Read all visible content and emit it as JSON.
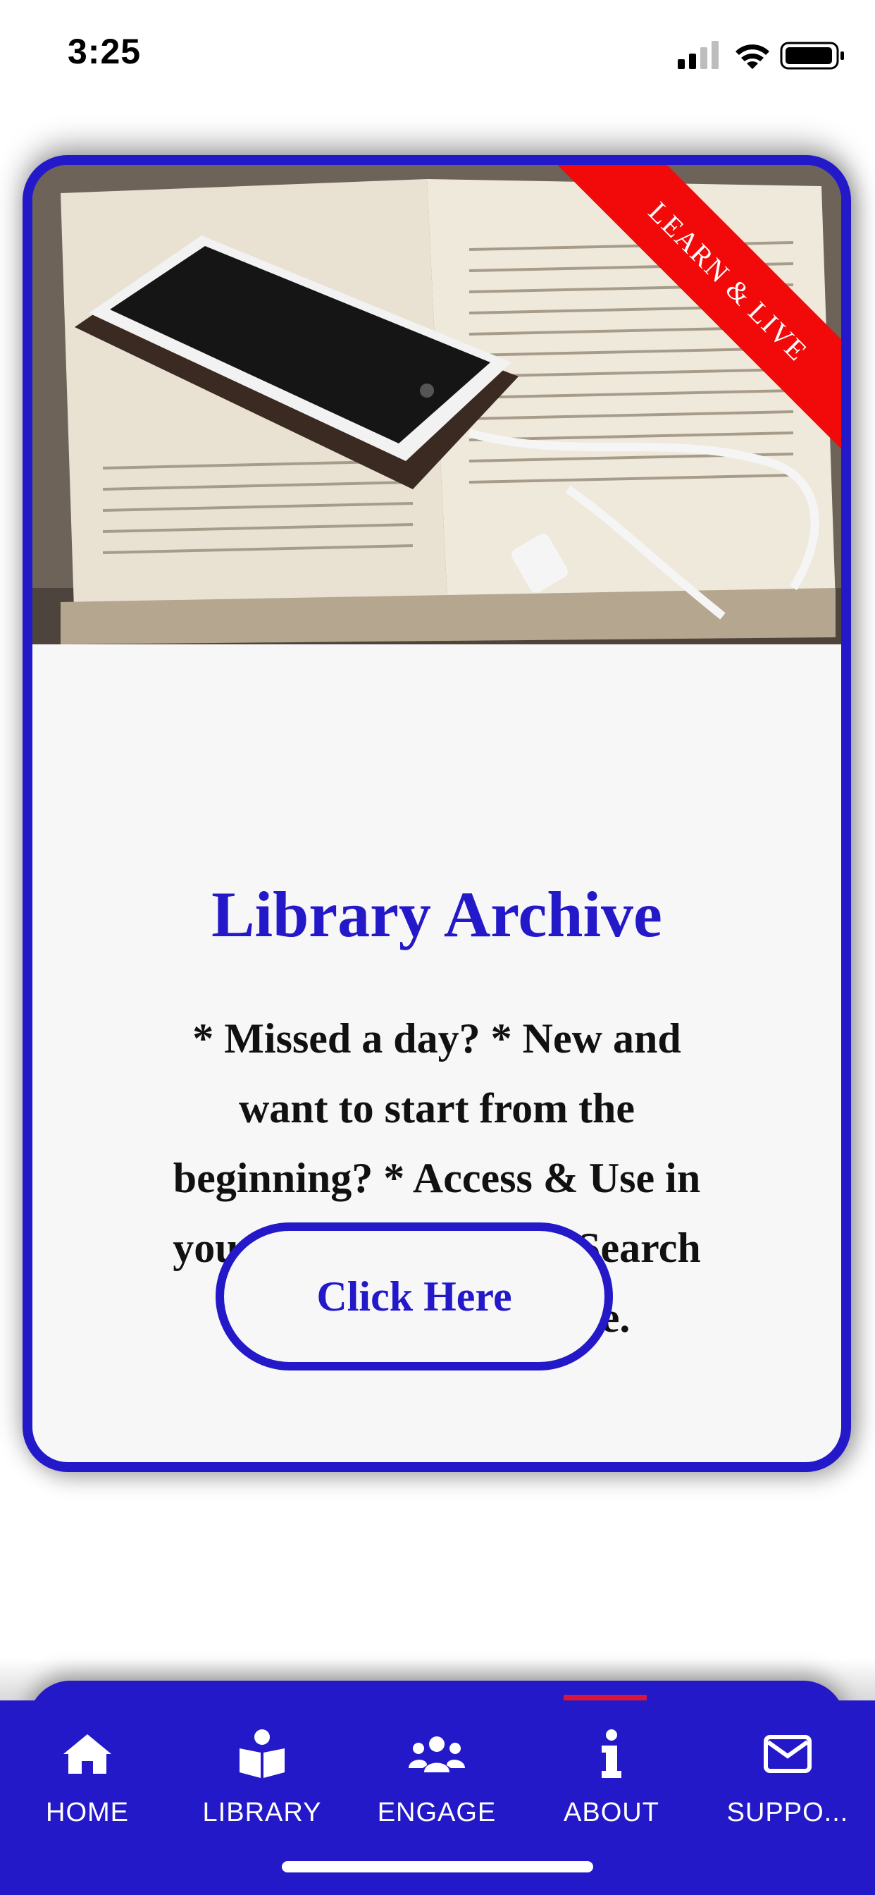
{
  "status_bar": {
    "time": "3:25"
  },
  "card": {
    "ribbon_text": "LEARN & LIVE",
    "title": "Library Archive",
    "description": "* Missed a day? * New and want to start from the beginning? * Access & Use in your Bible teaching. * Search for subject and verse.",
    "button_label": "Click Here"
  },
  "tab_bar": {
    "items": [
      {
        "label": "HOME",
        "icon": "home-icon"
      },
      {
        "label": "LIBRARY",
        "icon": "book-reader-icon"
      },
      {
        "label": "ENGAGE",
        "icon": "users-icon"
      },
      {
        "label": "ABOUT",
        "icon": "info-icon"
      },
      {
        "label": "SUPPO...",
        "icon": "envelope-icon"
      }
    ]
  },
  "colors": {
    "brand_blue": "#2419c8",
    "ribbon_red": "#f20a0a",
    "card_background": "#f7f7f7"
  }
}
